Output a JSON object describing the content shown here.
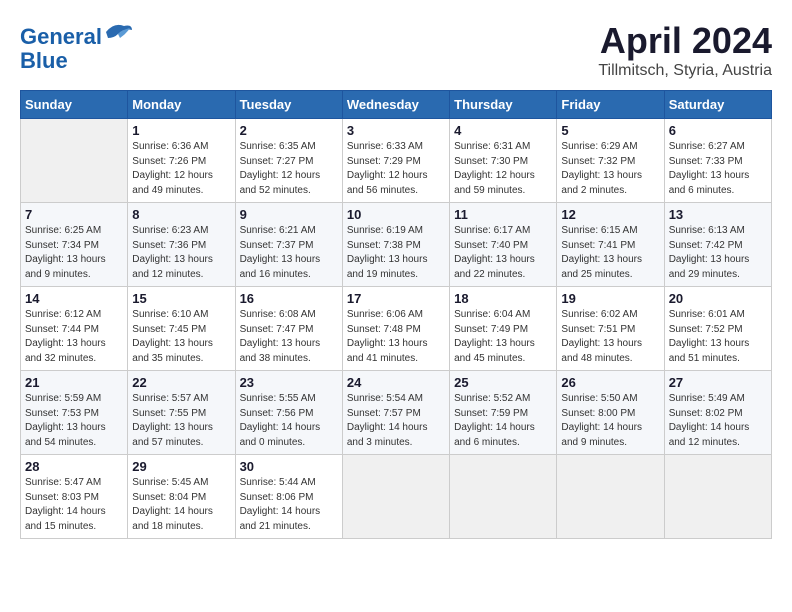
{
  "header": {
    "logo_line1": "General",
    "logo_line2": "Blue",
    "title": "April 2024",
    "subtitle": "Tillmitsch, Styria, Austria"
  },
  "days_of_week": [
    "Sunday",
    "Monday",
    "Tuesday",
    "Wednesday",
    "Thursday",
    "Friday",
    "Saturday"
  ],
  "weeks": [
    [
      {
        "day": "",
        "sunrise": "",
        "sunset": "",
        "daylight": ""
      },
      {
        "day": "1",
        "sunrise": "Sunrise: 6:36 AM",
        "sunset": "Sunset: 7:26 PM",
        "daylight": "Daylight: 12 hours and 49 minutes."
      },
      {
        "day": "2",
        "sunrise": "Sunrise: 6:35 AM",
        "sunset": "Sunset: 7:27 PM",
        "daylight": "Daylight: 12 hours and 52 minutes."
      },
      {
        "day": "3",
        "sunrise": "Sunrise: 6:33 AM",
        "sunset": "Sunset: 7:29 PM",
        "daylight": "Daylight: 12 hours and 56 minutes."
      },
      {
        "day": "4",
        "sunrise": "Sunrise: 6:31 AM",
        "sunset": "Sunset: 7:30 PM",
        "daylight": "Daylight: 12 hours and 59 minutes."
      },
      {
        "day": "5",
        "sunrise": "Sunrise: 6:29 AM",
        "sunset": "Sunset: 7:32 PM",
        "daylight": "Daylight: 13 hours and 2 minutes."
      },
      {
        "day": "6",
        "sunrise": "Sunrise: 6:27 AM",
        "sunset": "Sunset: 7:33 PM",
        "daylight": "Daylight: 13 hours and 6 minutes."
      }
    ],
    [
      {
        "day": "7",
        "sunrise": "Sunrise: 6:25 AM",
        "sunset": "Sunset: 7:34 PM",
        "daylight": "Daylight: 13 hours and 9 minutes."
      },
      {
        "day": "8",
        "sunrise": "Sunrise: 6:23 AM",
        "sunset": "Sunset: 7:36 PM",
        "daylight": "Daylight: 13 hours and 12 minutes."
      },
      {
        "day": "9",
        "sunrise": "Sunrise: 6:21 AM",
        "sunset": "Sunset: 7:37 PM",
        "daylight": "Daylight: 13 hours and 16 minutes."
      },
      {
        "day": "10",
        "sunrise": "Sunrise: 6:19 AM",
        "sunset": "Sunset: 7:38 PM",
        "daylight": "Daylight: 13 hours and 19 minutes."
      },
      {
        "day": "11",
        "sunrise": "Sunrise: 6:17 AM",
        "sunset": "Sunset: 7:40 PM",
        "daylight": "Daylight: 13 hours and 22 minutes."
      },
      {
        "day": "12",
        "sunrise": "Sunrise: 6:15 AM",
        "sunset": "Sunset: 7:41 PM",
        "daylight": "Daylight: 13 hours and 25 minutes."
      },
      {
        "day": "13",
        "sunrise": "Sunrise: 6:13 AM",
        "sunset": "Sunset: 7:42 PM",
        "daylight": "Daylight: 13 hours and 29 minutes."
      }
    ],
    [
      {
        "day": "14",
        "sunrise": "Sunrise: 6:12 AM",
        "sunset": "Sunset: 7:44 PM",
        "daylight": "Daylight: 13 hours and 32 minutes."
      },
      {
        "day": "15",
        "sunrise": "Sunrise: 6:10 AM",
        "sunset": "Sunset: 7:45 PM",
        "daylight": "Daylight: 13 hours and 35 minutes."
      },
      {
        "day": "16",
        "sunrise": "Sunrise: 6:08 AM",
        "sunset": "Sunset: 7:47 PM",
        "daylight": "Daylight: 13 hours and 38 minutes."
      },
      {
        "day": "17",
        "sunrise": "Sunrise: 6:06 AM",
        "sunset": "Sunset: 7:48 PM",
        "daylight": "Daylight: 13 hours and 41 minutes."
      },
      {
        "day": "18",
        "sunrise": "Sunrise: 6:04 AM",
        "sunset": "Sunset: 7:49 PM",
        "daylight": "Daylight: 13 hours and 45 minutes."
      },
      {
        "day": "19",
        "sunrise": "Sunrise: 6:02 AM",
        "sunset": "Sunset: 7:51 PM",
        "daylight": "Daylight: 13 hours and 48 minutes."
      },
      {
        "day": "20",
        "sunrise": "Sunrise: 6:01 AM",
        "sunset": "Sunset: 7:52 PM",
        "daylight": "Daylight: 13 hours and 51 minutes."
      }
    ],
    [
      {
        "day": "21",
        "sunrise": "Sunrise: 5:59 AM",
        "sunset": "Sunset: 7:53 PM",
        "daylight": "Daylight: 13 hours and 54 minutes."
      },
      {
        "day": "22",
        "sunrise": "Sunrise: 5:57 AM",
        "sunset": "Sunset: 7:55 PM",
        "daylight": "Daylight: 13 hours and 57 minutes."
      },
      {
        "day": "23",
        "sunrise": "Sunrise: 5:55 AM",
        "sunset": "Sunset: 7:56 PM",
        "daylight": "Daylight: 14 hours and 0 minutes."
      },
      {
        "day": "24",
        "sunrise": "Sunrise: 5:54 AM",
        "sunset": "Sunset: 7:57 PM",
        "daylight": "Daylight: 14 hours and 3 minutes."
      },
      {
        "day": "25",
        "sunrise": "Sunrise: 5:52 AM",
        "sunset": "Sunset: 7:59 PM",
        "daylight": "Daylight: 14 hours and 6 minutes."
      },
      {
        "day": "26",
        "sunrise": "Sunrise: 5:50 AM",
        "sunset": "Sunset: 8:00 PM",
        "daylight": "Daylight: 14 hours and 9 minutes."
      },
      {
        "day": "27",
        "sunrise": "Sunrise: 5:49 AM",
        "sunset": "Sunset: 8:02 PM",
        "daylight": "Daylight: 14 hours and 12 minutes."
      }
    ],
    [
      {
        "day": "28",
        "sunrise": "Sunrise: 5:47 AM",
        "sunset": "Sunset: 8:03 PM",
        "daylight": "Daylight: 14 hours and 15 minutes."
      },
      {
        "day": "29",
        "sunrise": "Sunrise: 5:45 AM",
        "sunset": "Sunset: 8:04 PM",
        "daylight": "Daylight: 14 hours and 18 minutes."
      },
      {
        "day": "30",
        "sunrise": "Sunrise: 5:44 AM",
        "sunset": "Sunset: 8:06 PM",
        "daylight": "Daylight: 14 hours and 21 minutes."
      },
      {
        "day": "",
        "sunrise": "",
        "sunset": "",
        "daylight": ""
      },
      {
        "day": "",
        "sunrise": "",
        "sunset": "",
        "daylight": ""
      },
      {
        "day": "",
        "sunrise": "",
        "sunset": "",
        "daylight": ""
      },
      {
        "day": "",
        "sunrise": "",
        "sunset": "",
        "daylight": ""
      }
    ]
  ]
}
